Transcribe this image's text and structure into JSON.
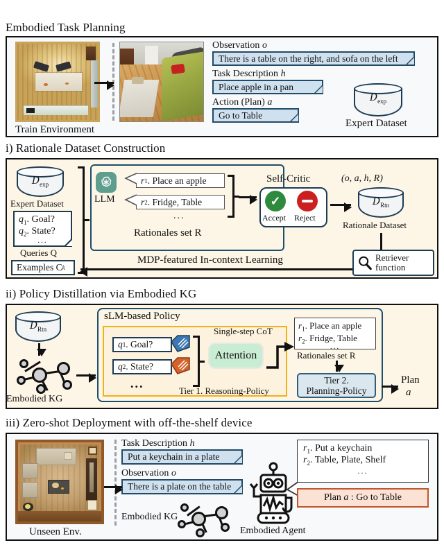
{
  "sections": {
    "top": {
      "title": "Embodied Task Planning",
      "train_env_caption": "Train Environment",
      "observation_label": "Observation",
      "observation_var": "o",
      "observation_text": "There is a table on the right, and sofa on the left",
      "task_label": "Task Description",
      "task_var": "h",
      "task_text": "Place apple in a pan",
      "action_label": "Action (Plan)",
      "action_var": "a",
      "action_text": "Go to Table",
      "dataset_symbol": "D",
      "dataset_sub": "exp",
      "dataset_caption": "Expert Dataset"
    },
    "i": {
      "title": "i) Rationale Dataset Construction",
      "expert_symbol": "D",
      "expert_sub": "exp",
      "expert_caption": "Expert Dataset",
      "queries": [
        {
          "var": "q",
          "sub": "1",
          "text": "Goal?"
        },
        {
          "var": "q",
          "sub": "2",
          "text": "State?"
        }
      ],
      "queries_ellipsis": "...",
      "queries_caption": "Queries Q",
      "examples_label": "Examples C",
      "examples_sub": "k",
      "llm_label": "LLM",
      "llm_icon": "openai-flower-icon",
      "rationales": [
        {
          "var": "r",
          "sub": "1",
          "text": "Place an apple"
        },
        {
          "var": "r",
          "sub": "2",
          "text": "Fridge, Table"
        }
      ],
      "rationales_ellipsis": "...",
      "rationales_caption": "Rationales set R",
      "self_critic_title": "Self-Critic",
      "accept_label": "Accept",
      "reject_label": "Reject",
      "tuple_label": "(o, a, h, R)",
      "rtn_symbol": "D",
      "rtn_sub": "Rtn",
      "rtn_caption": "Rationale Dataset",
      "retriever_line1": "Retriever",
      "retriever_line2": "function",
      "icl_label": "MDP-featured In-context Learning"
    },
    "ii": {
      "title": "ii) Policy Distillation via Embodied KG",
      "rtn_symbol": "D",
      "rtn_sub": "Rtn",
      "kg_caption": "Embodied KG",
      "policy_title": "sLM-based Policy",
      "queries": [
        {
          "var": "q",
          "sub": "1",
          "text": "Goal?",
          "tag_color": "#3c78b4"
        },
        {
          "var": "q",
          "sub": "2",
          "text": "State?",
          "tag_color": "#d4622a"
        }
      ],
      "queries_ellipsis": "...",
      "cot_label": "Single-step CoT",
      "attention_label": "Attention",
      "tier1_label": "Tier 1. Reasoning-Policy",
      "rationales": [
        {
          "var": "r",
          "sub": "1",
          "text": "Place an apple"
        },
        {
          "var": "r",
          "sub": "2",
          "text": "Fridge, Table"
        }
      ],
      "rationales_ellipsis": "...",
      "rationales_caption": "Rationales set R",
      "tier2_line1": "Tier 2.",
      "tier2_line2": "Planning-Policy",
      "plan_label": "Plan",
      "plan_var": "a"
    },
    "iii": {
      "title": "iii) Zero-shot Deployment with off-the-shelf device",
      "unseen_caption": "Unseen Env.",
      "task_label": "Task Description",
      "task_var": "h",
      "task_text": "Put a keychain in a plate",
      "observation_label": "Observation",
      "observation_var": "o",
      "observation_text": "There is a plate on the table",
      "kg_caption": "Embodied KG",
      "agent_caption": "Embodied Agent",
      "rationales": [
        {
          "var": "r",
          "sub": "1",
          "text": "Put a keychain"
        },
        {
          "var": "r",
          "sub": "2",
          "text": "Table, Plate, Shelf"
        }
      ],
      "rationales_ellipsis": "...",
      "plan_prefix": "Plan",
      "plan_var": "a",
      "plan_text": ": Go to Table"
    }
  },
  "colors": {
    "bubble_fill": "#cfe0ef",
    "bubble_border": "#234a66",
    "panel_cream": "#fdf6e6",
    "panel_light": "#f7f9fb",
    "accept_green": "#2e8b3d",
    "reject_red": "#cc1f1f",
    "attention_green": "#c9edd3",
    "tier2_blue": "#dbe7ef",
    "plan_peach": "#fbe2d5",
    "plan_border": "#c0562a",
    "tag_blue": "#3c78b4",
    "tag_orange": "#d4622a",
    "llm_teal": "#5f9e8f",
    "cot_yellow": "#f0b01e"
  }
}
